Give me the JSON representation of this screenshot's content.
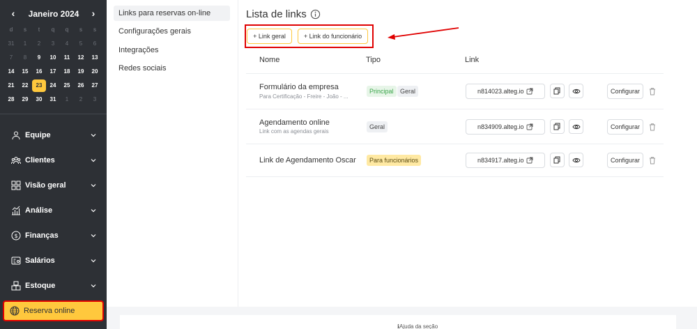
{
  "calendar": {
    "title": "Janeiro 2024",
    "weekdays": [
      "d",
      "s",
      "t",
      "q",
      "q",
      "s",
      "s"
    ],
    "weeks": [
      [
        {
          "d": "31",
          "m": true
        },
        {
          "d": "1",
          "m": true
        },
        {
          "d": "2",
          "m": true
        },
        {
          "d": "3",
          "m": true
        },
        {
          "d": "4",
          "m": true
        },
        {
          "d": "5",
          "m": true
        },
        {
          "d": "6",
          "m": true
        }
      ],
      [
        {
          "d": "7",
          "m": true
        },
        {
          "d": "8",
          "m": true
        },
        {
          "d": "9"
        },
        {
          "d": "10"
        },
        {
          "d": "11"
        },
        {
          "d": "12"
        },
        {
          "d": "13"
        }
      ],
      [
        {
          "d": "14"
        },
        {
          "d": "15"
        },
        {
          "d": "16"
        },
        {
          "d": "17"
        },
        {
          "d": "18"
        },
        {
          "d": "19"
        },
        {
          "d": "20"
        }
      ],
      [
        {
          "d": "21"
        },
        {
          "d": "22"
        },
        {
          "d": "23",
          "today": true
        },
        {
          "d": "24"
        },
        {
          "d": "25"
        },
        {
          "d": "26"
        },
        {
          "d": "27"
        }
      ],
      [
        {
          "d": "28"
        },
        {
          "d": "29"
        },
        {
          "d": "30"
        },
        {
          "d": "31"
        },
        {
          "d": "1",
          "m": true
        },
        {
          "d": "2",
          "m": true
        },
        {
          "d": "3",
          "m": true
        }
      ]
    ]
  },
  "menu": [
    {
      "key": "equipe",
      "label": "Equipe",
      "icon": "user-icon"
    },
    {
      "key": "clientes",
      "label": "Clientes",
      "icon": "clients-icon"
    },
    {
      "key": "visao",
      "label": "Visão geral",
      "icon": "grid-icon"
    },
    {
      "key": "analise",
      "label": "Análise",
      "icon": "analytics-icon"
    },
    {
      "key": "financas",
      "label": "Finanças",
      "icon": "dollar-icon"
    },
    {
      "key": "salarios",
      "label": "Salários",
      "icon": "payroll-icon"
    },
    {
      "key": "estoque",
      "label": "Estoque",
      "icon": "boxes-icon"
    }
  ],
  "active_menu": {
    "label": "Reserva online",
    "icon": "globe-icon"
  },
  "subnav": [
    {
      "label": "Links para reservas on-line",
      "active": true
    },
    {
      "label": "Configurações gerais"
    },
    {
      "label": "Integrações"
    },
    {
      "label": "Redes sociais"
    }
  ],
  "main": {
    "title": "Lista de links",
    "btn_link_geral": "Link geral",
    "btn_link_funcionario": "Link do funcionário",
    "columns": {
      "nome": "Nome",
      "tipo": "Tipo",
      "link": "Link"
    },
    "rows": [
      {
        "name": "Formulário da empresa",
        "sub": "Para Certificação - Freire - João - ...",
        "tags": [
          {
            "text": "Principal",
            "kind": "principal"
          },
          {
            "text": "Geral",
            "kind": "geral"
          }
        ],
        "link": "n814023.alteg.io",
        "configure": "Configurar"
      },
      {
        "name": "Agendamento online",
        "sub": "Link com as agendas gerais",
        "tags": [
          {
            "text": "Geral",
            "kind": "geral"
          }
        ],
        "link": "n834909.alteg.io",
        "configure": "Configurar"
      },
      {
        "name": "Link de Agendamento Oscar",
        "sub": "",
        "tags": [
          {
            "text": "Para funcionários",
            "kind": "func"
          }
        ],
        "link": "n834917.alteg.io",
        "configure": "Configurar"
      }
    ]
  },
  "footer": {
    "help": "Ajuda da seção"
  },
  "colors": {
    "accent": "#ffc83d",
    "sidebar": "#2d3035",
    "highlight": "#e00000"
  }
}
